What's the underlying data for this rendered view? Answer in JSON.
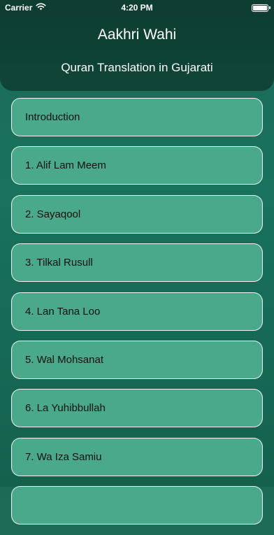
{
  "status_bar": {
    "carrier": "Carrier",
    "time": "4:20 PM",
    "battery_level": 1.0,
    "wifi_icon": "wifi-icon",
    "battery_icon": "battery-icon"
  },
  "header": {
    "title": "Aakhri Wahi",
    "subtitle": "Quran Translation in Gujarati"
  },
  "colors": {
    "header_background": "#0e3d32",
    "page_background": "#18725c",
    "item_background": "#4aa98a",
    "item_border": "#ffffff"
  },
  "chapters": [
    {
      "label": "Introduction"
    },
    {
      "label": "1. Alif Lam Meem"
    },
    {
      "label": "2. Sayaqool"
    },
    {
      "label": "3. Tilkal Rusull"
    },
    {
      "label": "4. Lan Tana Loo"
    },
    {
      "label": "5. Wal Mohsanat"
    },
    {
      "label": "6. La Yuhibbullah"
    },
    {
      "label": "7. Wa Iza Samiu"
    },
    {
      "label": ""
    }
  ]
}
